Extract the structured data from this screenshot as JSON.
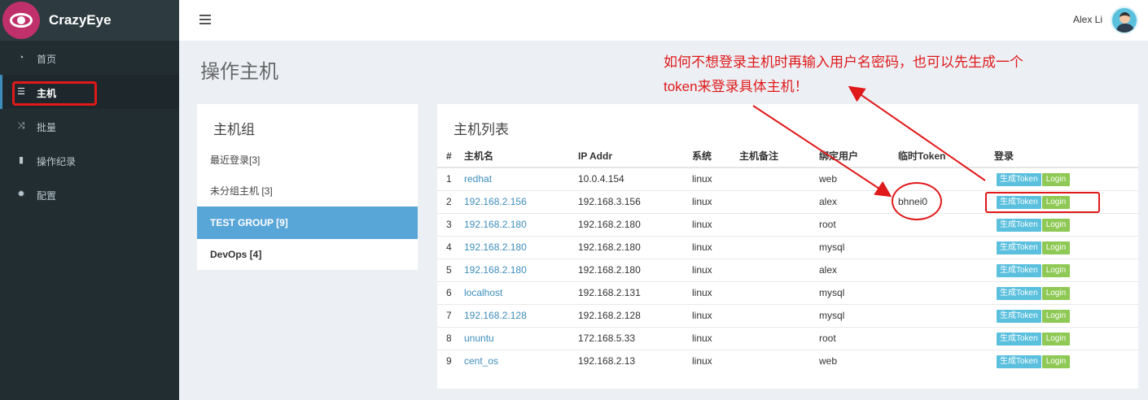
{
  "brand": {
    "name": "CrazyEye"
  },
  "sidebar": {
    "items": [
      {
        "icon": "dashboard-icon",
        "label": "首页",
        "active": false
      },
      {
        "icon": "server-icon",
        "label": "主机",
        "active": true
      },
      {
        "icon": "shuffle-icon",
        "label": "批量",
        "active": false
      },
      {
        "icon": "book-icon",
        "label": "操作纪录",
        "active": false
      },
      {
        "icon": "gear-icon",
        "label": "配置",
        "active": false
      }
    ]
  },
  "header": {
    "user_name": "Alex Li"
  },
  "page": {
    "title": "操作主机"
  },
  "annotation": {
    "line1": "如何不想登录主机时再输入用户名密码，也可以先生成一个",
    "line2": "token来登录具体主机！"
  },
  "groups": {
    "title": "主机组",
    "items": [
      "最近登录[3]",
      "未分组主机 [3]",
      "TEST GROUP [9]",
      "DevOps [4]"
    ]
  },
  "hosts": {
    "title": "主机列表",
    "columns": [
      "#",
      "主机名",
      "IP Addr",
      "系统",
      "主机备注",
      "绑定用户",
      "临时Token",
      "登录"
    ],
    "token_button": "生成Token",
    "login_button": "Login",
    "rows": [
      {
        "num": "1",
        "name": "redhat",
        "ip": "10.0.4.154",
        "os": "linux",
        "note": "",
        "user": "web",
        "token": ""
      },
      {
        "num": "2",
        "name": "192.168.2.156",
        "ip": "192.168.3.156",
        "os": "linux",
        "note": "",
        "user": "alex",
        "token": "bhnei0"
      },
      {
        "num": "3",
        "name": "192.168.2.180",
        "ip": "192.168.2.180",
        "os": "linux",
        "note": "",
        "user": "root",
        "token": ""
      },
      {
        "num": "4",
        "name": "192.168.2.180",
        "ip": "192.168.2.180",
        "os": "linux",
        "note": "",
        "user": "mysql",
        "token": ""
      },
      {
        "num": "5",
        "name": "192.168.2.180",
        "ip": "192.168.2.180",
        "os": "linux",
        "note": "",
        "user": "alex",
        "token": ""
      },
      {
        "num": "6",
        "name": "localhost",
        "ip": "192.168.2.131",
        "os": "linux",
        "note": "",
        "user": "mysql",
        "token": ""
      },
      {
        "num": "7",
        "name": "192.168.2.128",
        "ip": "192.168.2.128",
        "os": "linux",
        "note": "",
        "user": "mysql",
        "token": ""
      },
      {
        "num": "8",
        "name": "ununtu",
        "ip": "172.168.5.33",
        "os": "linux",
        "note": "",
        "user": "root",
        "token": ""
      },
      {
        "num": "9",
        "name": "cent_os",
        "ip": "192.168.2.13",
        "os": "linux",
        "note": "",
        "user": "web",
        "token": ""
      }
    ]
  },
  "colors": {
    "accent": "#3c8dbc",
    "sidebar_bg": "#222d32",
    "annotation_red": "#e0191a",
    "token_btn": "#5bc0de",
    "login_btn": "#8fc955"
  }
}
